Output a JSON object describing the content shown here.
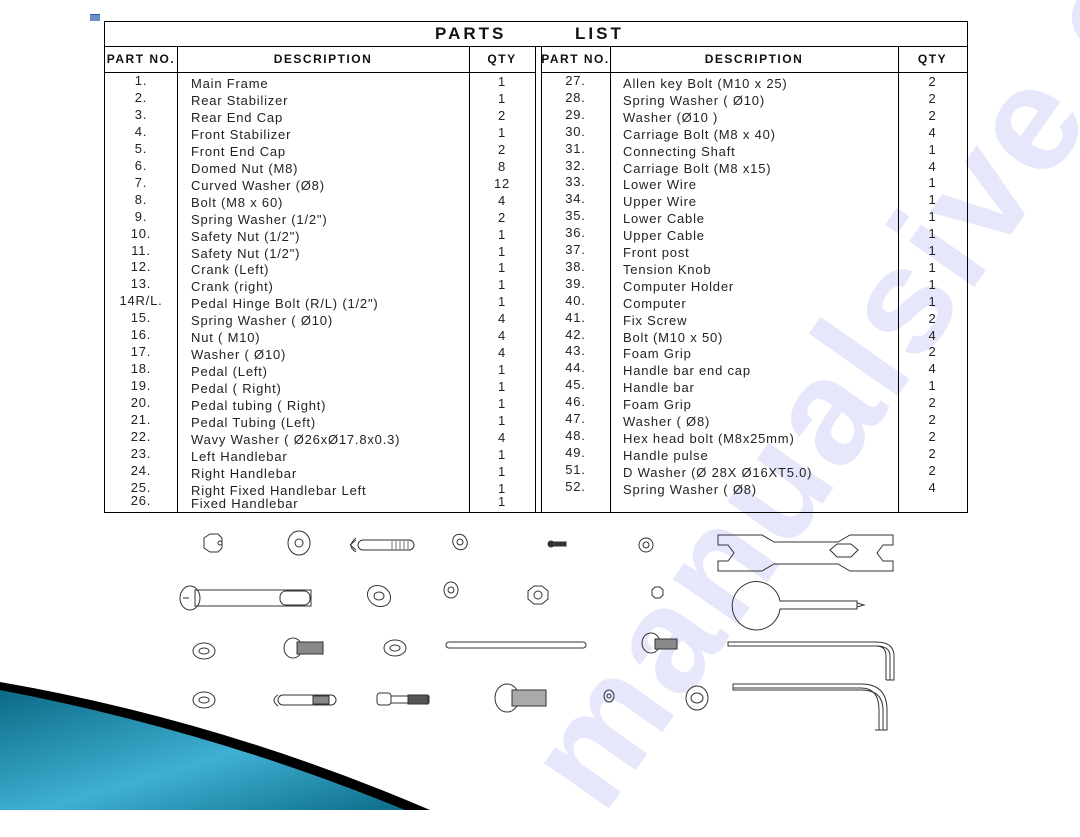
{
  "document": {
    "title_left": "PARTS",
    "title_right": "LIST",
    "headers": {
      "part_no": "PART NO.",
      "description": "DESCRIPTION",
      "qty": "QTY"
    },
    "left_parts": [
      {
        "no": "1.",
        "desc": "Main Frame",
        "qty": "1"
      },
      {
        "no": "2.",
        "desc": "Rear Stabilizer",
        "qty": "1"
      },
      {
        "no": "3.",
        "desc": "Rear End Cap",
        "qty": "2"
      },
      {
        "no": "4.",
        "desc": "Front Stabilizer",
        "qty": "1"
      },
      {
        "no": "5.",
        "desc": "Front End Cap",
        "qty": "2"
      },
      {
        "no": "6.",
        "desc": "Domed Nut (M8)",
        "qty": "8"
      },
      {
        "no": "7.",
        "desc": "Curved Washer  (Ø8)",
        "qty": "12"
      },
      {
        "no": "8.",
        "desc": "Bolt (M8  x  60)",
        "qty": "4"
      },
      {
        "no": "9.",
        "desc": "Spring Washer (1/2\")",
        "qty": "2"
      },
      {
        "no": "10.",
        "desc": "Safety Nut (1/2\")",
        "qty": "1"
      },
      {
        "no": "11.",
        "desc": "Safety Nut (1/2\")",
        "qty": "1"
      },
      {
        "no": "12.",
        "desc": "Crank  (Left)",
        "qty": "1"
      },
      {
        "no": "13.",
        "desc": "Crank  (right)",
        "qty": "1"
      },
      {
        "no": "14R/L.",
        "desc": "Pedal Hinge Bolt (R/L)  (1/2\")",
        "qty": "1"
      },
      {
        "no": "15.",
        "desc": "Spring Washer (  Ø10)",
        "qty": "4"
      },
      {
        "no": "16.",
        "desc": "Nut ( M10)",
        "qty": "4"
      },
      {
        "no": "17.",
        "desc": "Washer (  Ø10)",
        "qty": "4"
      },
      {
        "no": "18.",
        "desc": "Pedal  (Left)",
        "qty": "1"
      },
      {
        "no": "19.",
        "desc": "Pedal ( Right)",
        "qty": "1"
      },
      {
        "no": "20.",
        "desc": "Pedal tubing ( Right)",
        "qty": "1"
      },
      {
        "no": "21.",
        "desc": "Pedal Tubing (Left)",
        "qty": "1"
      },
      {
        "no": "22.",
        "desc": "Wavy Washer (  Ø26xØ17.8x0.3)",
        "qty": "4"
      },
      {
        "no": "23.",
        "desc": "Left Handlebar",
        "qty": "1"
      },
      {
        "no": "24.",
        "desc": "Right Handlebar",
        "qty": "1"
      },
      {
        "no": "25.",
        "desc": "Right Fixed Handlebar Left",
        "qty": "1"
      },
      {
        "no": "26.",
        "desc": "Fixed Handlebar",
        "qty": "1"
      }
    ],
    "right_parts": [
      {
        "no": "27.",
        "desc": "Allen key Bolt (M10 x 25)",
        "qty": "2"
      },
      {
        "no": "28.",
        "desc": "Spring Washer (  Ø10)",
        "qty": "2"
      },
      {
        "no": "29.",
        "desc": "Washer (Ø10  )",
        "qty": "2"
      },
      {
        "no": "30.",
        "desc": "Carriage Bolt (M8 x 40)",
        "qty": "4"
      },
      {
        "no": "31.",
        "desc": "Connecting Shaft",
        "qty": "1"
      },
      {
        "no": "32.",
        "desc": "Carriage Bolt (M8 x15)",
        "qty": "4"
      },
      {
        "no": "33.",
        "desc": "Lower Wire",
        "qty": "1"
      },
      {
        "no": "34.",
        "desc": "Upper Wire",
        "qty": "1"
      },
      {
        "no": "35.",
        "desc": "Lower Cable",
        "qty": "1"
      },
      {
        "no": "36.",
        "desc": "Upper Cable",
        "qty": "1"
      },
      {
        "no": "37.",
        "desc": "Front post",
        "qty": "1"
      },
      {
        "no": "38.",
        "desc": "Tension Knob",
        "qty": "1"
      },
      {
        "no": "39.",
        "desc": "Computer Holder",
        "qty": "1"
      },
      {
        "no": "40.",
        "desc": "Computer",
        "qty": "1"
      },
      {
        "no": "41.",
        "desc": "Fix Screw",
        "qty": "2"
      },
      {
        "no": "42.",
        "desc": "Bolt (M10 x 50)",
        "qty": "4"
      },
      {
        "no": "43.",
        "desc": "Foam Grip",
        "qty": "2"
      },
      {
        "no": "44.",
        "desc": "Handle bar end cap",
        "qty": "4"
      },
      {
        "no": "45.",
        "desc": "Handle bar",
        "qty": "1"
      },
      {
        "no": "46.",
        "desc": "Foam Grip",
        "qty": "2"
      },
      {
        "no": "47.",
        "desc": "Washer (  Ø8)",
        "qty": "2"
      },
      {
        "no": "48.",
        "desc": "Hex head bolt (M8x25mm)",
        "qty": "2"
      },
      {
        "no": "49.",
        "desc": "Handle pulse",
        "qty": "2"
      },
      {
        "no": "51.",
        "desc": "D Washer (Ø 28X  Ø16XT5.0)",
        "qty": "2"
      },
      {
        "no": "52.",
        "desc": "Spring Washer (  Ø8)",
        "qty": "4"
      }
    ],
    "watermark_text": "manualsive.com",
    "hardware_icons": [
      "domed-nut-icon",
      "curved-washer-icon",
      "carriage-bolt-icon",
      "spring-washer-icon",
      "small-screw-icon",
      "small-washer-icon",
      "wrench-icon",
      "long-bolt-icon",
      "large-washer-icon",
      "spring-washer-icon",
      "safety-nut-icon",
      "small-nut-icon",
      "combo-wrench-screwdriver-icon",
      "flat-washer-icon",
      "allen-bolt-icon",
      "washer-icon",
      "connecting-shaft-icon",
      "button-head-bolt-icon",
      "allen-key-icon",
      "flat-washer-icon",
      "carriage-bolt-icon",
      "hex-head-bolt-icon",
      "large-allen-bolt-icon",
      "small-spring-washer-icon",
      "d-washer-icon",
      "allen-key-icon"
    ],
    "colors": {
      "accent_teal": "#1f8fb0",
      "accent_dark": "#0b5f7a",
      "watermark": "#7878f0"
    }
  }
}
